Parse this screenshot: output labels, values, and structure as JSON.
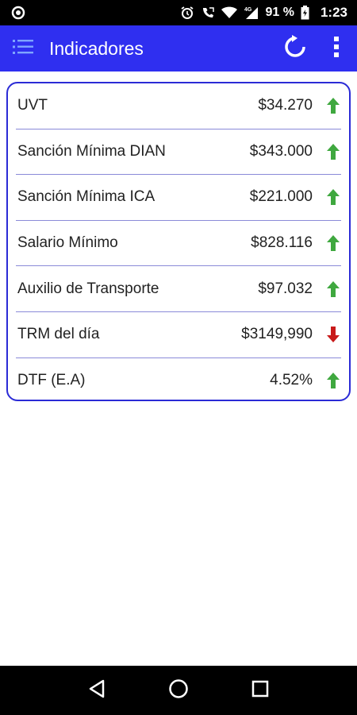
{
  "status_bar": {
    "battery": "91 %",
    "time": "1:23",
    "network": "4G"
  },
  "app_bar": {
    "title": "Indicadores"
  },
  "indicators": [
    {
      "label": "UVT",
      "value": "$34.270",
      "trend": "up"
    },
    {
      "label": "Sanción Mínima DIAN",
      "value": "$343.000",
      "trend": "up"
    },
    {
      "label": "Sanción Mínima ICA",
      "value": "$221.000",
      "trend": "up"
    },
    {
      "label": "Salario Mínimo",
      "value": "$828.116",
      "trend": "up"
    },
    {
      "label": "Auxilio de Transporte",
      "value": "$97.032",
      "trend": "up"
    },
    {
      "label": "TRM del día",
      "value": "$3149,990",
      "trend": "down"
    },
    {
      "label": "DTF (E.A)",
      "value": "4.52%",
      "trend": "up"
    }
  ],
  "colors": {
    "app_bar": "#2f2ff0",
    "card_border": "#2b2bd6",
    "trend_up": "#3fa83f",
    "trend_down": "#c81a1a"
  }
}
